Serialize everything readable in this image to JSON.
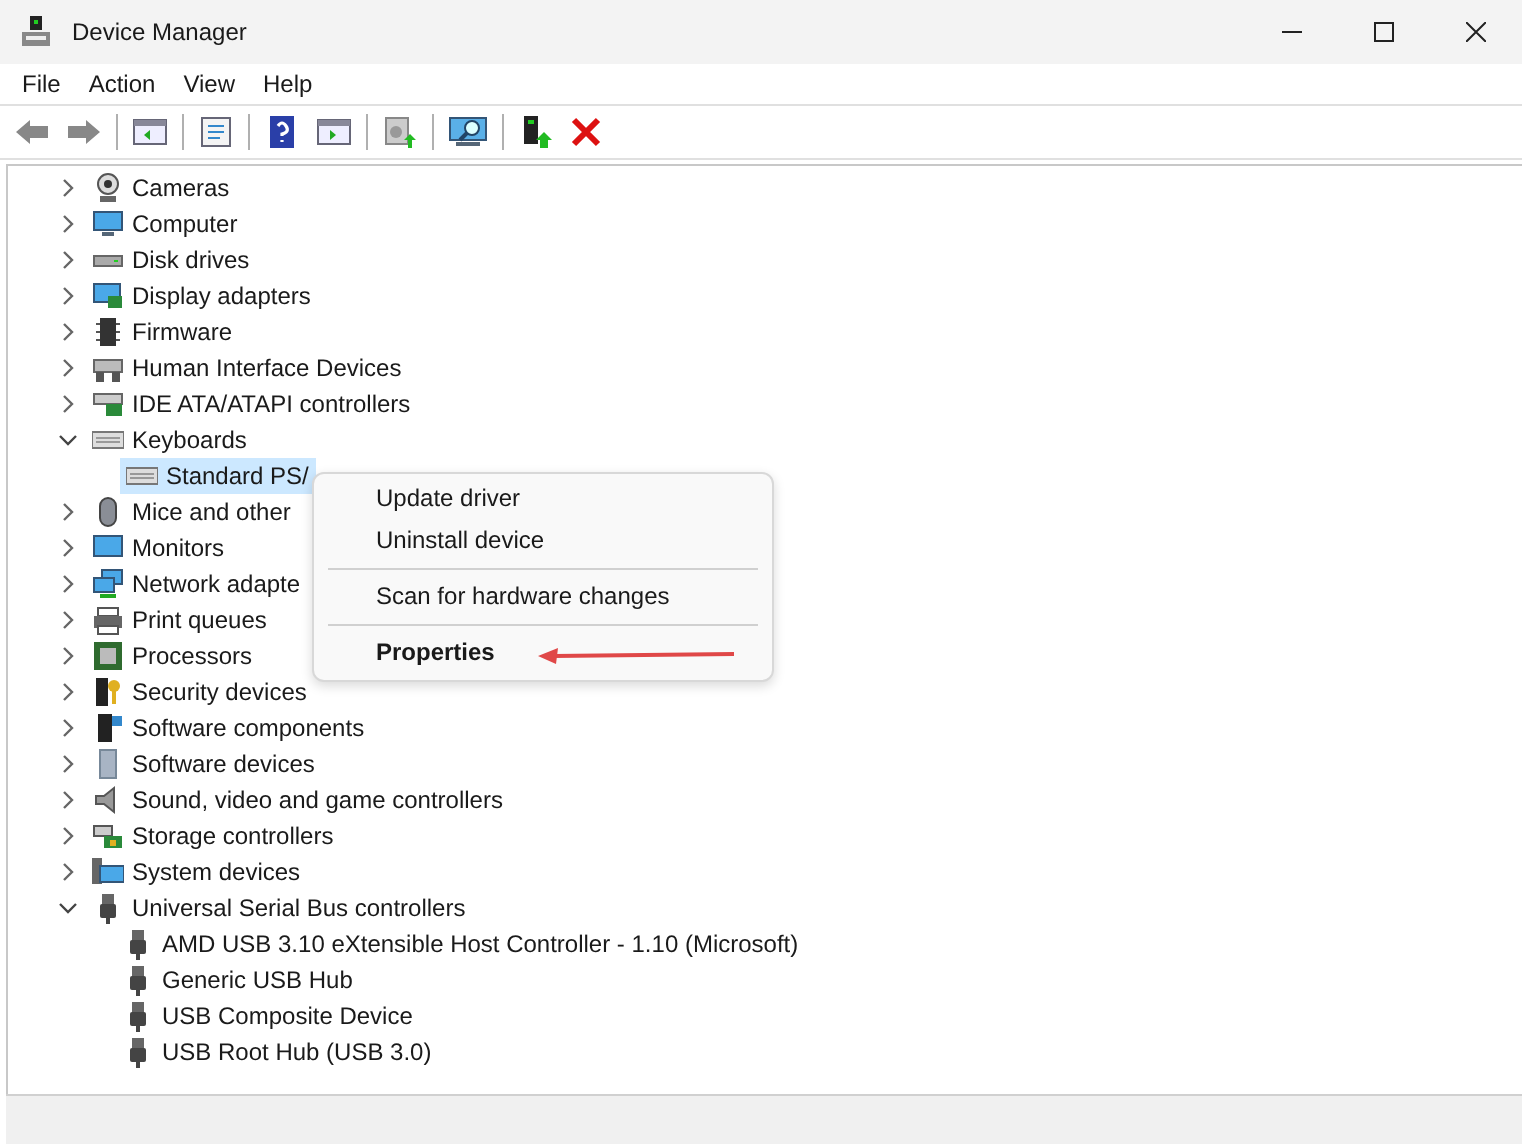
{
  "window": {
    "title": "Device Manager"
  },
  "menu_bar": [
    "File",
    "Action",
    "View",
    "Help"
  ],
  "tree": [
    {
      "label": "Cameras",
      "expanded": false
    },
    {
      "label": "Computer",
      "expanded": false
    },
    {
      "label": "Disk drives",
      "expanded": false
    },
    {
      "label": "Display adapters",
      "expanded": false
    },
    {
      "label": "Firmware",
      "expanded": false
    },
    {
      "label": "Human Interface Devices",
      "expanded": false
    },
    {
      "label": "IDE ATA/ATAPI controllers",
      "expanded": false
    },
    {
      "label": "Keyboards",
      "expanded": true,
      "children": [
        {
          "label": "Standard PS/",
          "selected": true
        }
      ]
    },
    {
      "label": "Mice and other",
      "expanded": false
    },
    {
      "label": "Monitors",
      "expanded": false
    },
    {
      "label": "Network adapte",
      "expanded": false
    },
    {
      "label": "Print queues",
      "expanded": false
    },
    {
      "label": "Processors",
      "expanded": false
    },
    {
      "label": "Security devices",
      "expanded": false
    },
    {
      "label": "Software components",
      "expanded": false
    },
    {
      "label": "Software devices",
      "expanded": false
    },
    {
      "label": "Sound, video and game controllers",
      "expanded": false
    },
    {
      "label": "Storage controllers",
      "expanded": false
    },
    {
      "label": "System devices",
      "expanded": false
    },
    {
      "label": "Universal Serial Bus controllers",
      "expanded": true,
      "children": [
        {
          "label": "AMD USB 3.10 eXtensible Host Controller - 1.10 (Microsoft)",
          "selected": false
        },
        {
          "label": "Generic USB Hub",
          "selected": false
        },
        {
          "label": "USB Composite Device",
          "selected": false
        },
        {
          "label": "USB Root Hub (USB 3.0)",
          "selected": false
        }
      ]
    }
  ],
  "context_menu": [
    {
      "kind": "item",
      "label": "Update driver"
    },
    {
      "kind": "item",
      "label": "Uninstall device"
    },
    {
      "kind": "separator"
    },
    {
      "kind": "item",
      "label": "Scan for hardware changes"
    },
    {
      "kind": "separator"
    },
    {
      "kind": "default",
      "label": "Properties"
    }
  ]
}
